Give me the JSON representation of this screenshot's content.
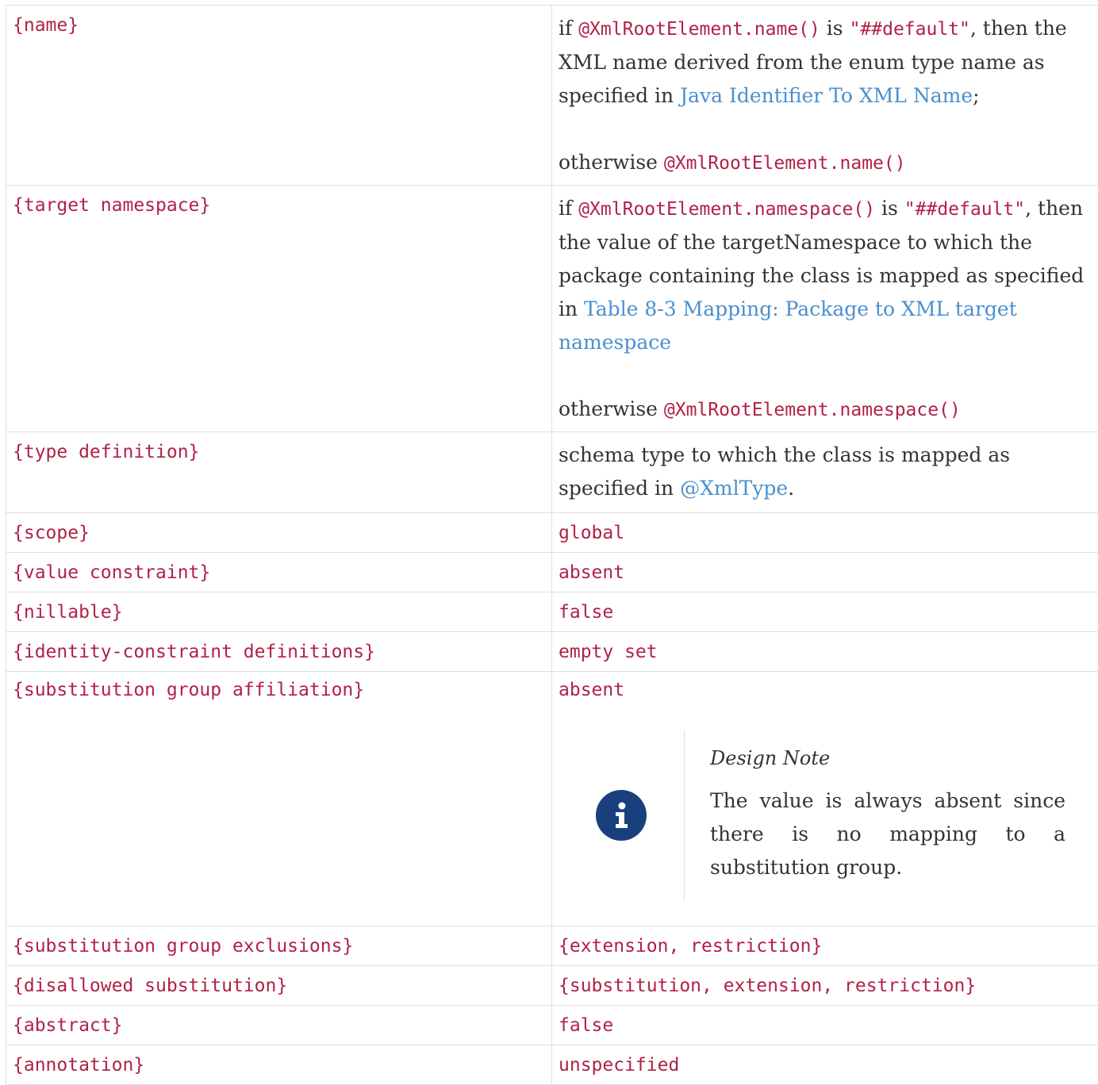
{
  "rows": [
    {
      "property": "{name}",
      "value": {
        "p1": {
          "t1": "if ",
          "c1": "@XmlRootElement.name()",
          "t2": " is ",
          "c2": "\"##default\"",
          "t3": ", then the XML name derived from the enum type name as specified in ",
          "link": "Java Identifier To XML Name",
          "t4": ";"
        },
        "p2": {
          "t1": "otherwise ",
          "c1": "@XmlRootElement.name()"
        }
      }
    },
    {
      "property": "{target namespace}",
      "value": {
        "p1": {
          "t1": "if ",
          "c1": "@XmlRootElement.namespace()",
          "t2": " is ",
          "c2": "\"##default\"",
          "t3": ", then the value of the targetNamespace to which the package containing the class is mapped as specified in ",
          "link": "Table 8-3 Mapping: Package to XML target namespace"
        },
        "p2": {
          "t1": "otherwise ",
          "c1": "@XmlRootElement.namespace()"
        }
      }
    },
    {
      "property": "{type definition}",
      "value": {
        "t1": "schema type to which the class is mapped as specified in ",
        "link": "@XmlType",
        "t2": "."
      }
    },
    {
      "property": "{scope}",
      "value": "global"
    },
    {
      "property": "{value constraint}",
      "value": "absent"
    },
    {
      "property": "{nillable}",
      "value": "false"
    },
    {
      "property": "{identity-constraint definitions}",
      "value": "empty set"
    },
    {
      "property": "{substitution group affiliation}",
      "value": "absent",
      "note": {
        "icon": "info-icon",
        "title": "Design Note",
        "body": "The value is always absent since there is no mapping to a substitution group."
      }
    },
    {
      "property": "{substitution group exclusions}",
      "value": "{extension, restriction}"
    },
    {
      "property": "{disallowed substitution}",
      "value": "{substitution, extension, restriction}"
    },
    {
      "property": "{abstract}",
      "value": "false"
    },
    {
      "property": "{annotation}",
      "value": "unspecified"
    }
  ]
}
